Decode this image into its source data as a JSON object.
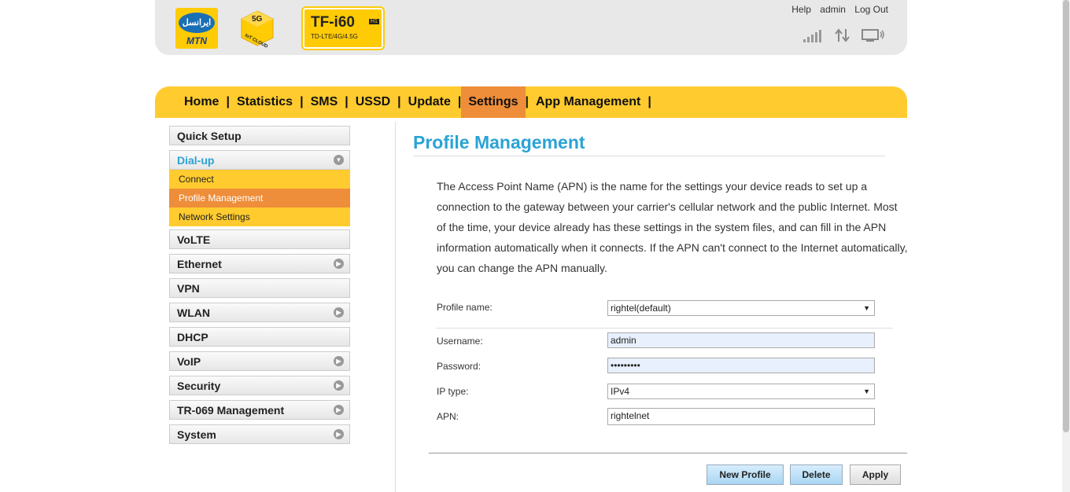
{
  "header": {
    "mtn_logo_text": "ایرانسل",
    "mtn_logo_brand": "MTN",
    "cube_logo_top": "5G",
    "cube_logo_bottom": "IoT CLOUD",
    "device_model": "TF-i60",
    "device_badge": "H1",
    "device_subtitle": "TD-LTE/4G/4.5G",
    "links": {
      "help": "Help",
      "user": "admin",
      "logout": "Log Out"
    },
    "icons": [
      "signal-icon",
      "transfer-icon",
      "pc-connection-icon"
    ]
  },
  "nav": {
    "items": [
      "Home",
      "Statistics",
      "SMS",
      "USSD",
      "Update",
      "Settings",
      "App Management"
    ],
    "active": "Settings"
  },
  "sidebar": {
    "quick_setup": "Quick Setup",
    "dialup": "Dial-up",
    "dialup_sub": [
      "Connect",
      "Profile Management",
      "Network Settings"
    ],
    "active_sub": "Profile Management",
    "rest": [
      {
        "label": "VoLTE",
        "arrow": false
      },
      {
        "label": "Ethernet",
        "arrow": true
      },
      {
        "label": "VPN",
        "arrow": false
      },
      {
        "label": "WLAN",
        "arrow": true
      },
      {
        "label": "DHCP",
        "arrow": false
      },
      {
        "label": "VoIP",
        "arrow": true
      },
      {
        "label": "Security",
        "arrow": true
      },
      {
        "label": "TR-069 Management",
        "arrow": true
      },
      {
        "label": "System",
        "arrow": true
      }
    ]
  },
  "main": {
    "title": "Profile Management",
    "description": "The Access Point Name (APN) is the name for the settings your device reads to set up a connection to the gateway between your carrier's cellular network and the public Internet. Most of the time, your device already has these settings in the system files, and can fill in the APN information automatically when it connects. If the APN can't connect to the Internet automatically, you can change the APN manually.",
    "form": {
      "profile_label": "Profile name:",
      "profile_value": "rightel(default)",
      "username_label": "Username:",
      "username_value": "admin",
      "password_label": "Password:",
      "password_value": "•••••••••",
      "iptype_label": "IP type:",
      "iptype_value": "IPv4",
      "apn_label": "APN:",
      "apn_value": "rightelnet"
    },
    "buttons": {
      "new_profile": "New Profile",
      "delete": "Delete",
      "apply": "Apply"
    }
  }
}
